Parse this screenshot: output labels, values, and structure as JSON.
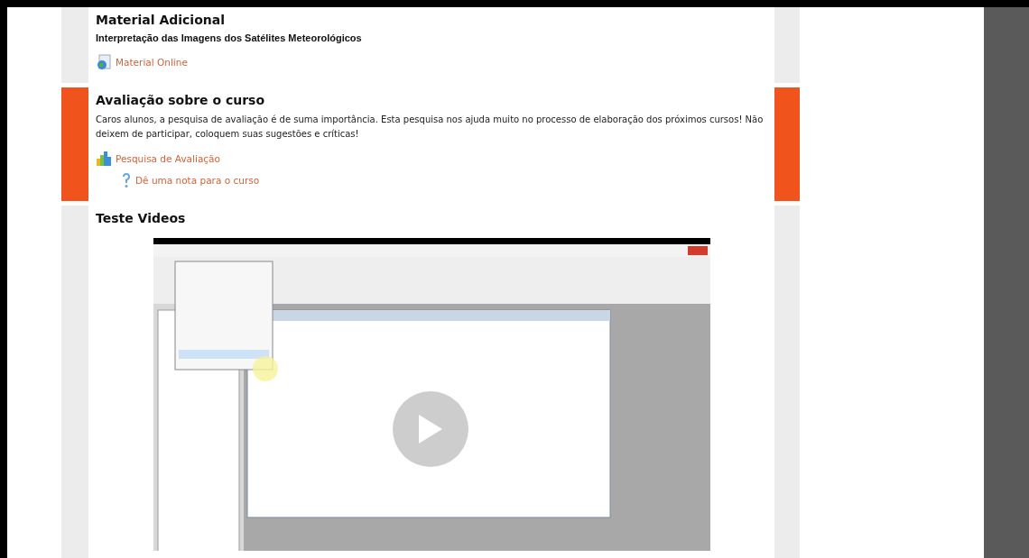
{
  "sections": [
    {
      "kind": "plain",
      "highlighted": false,
      "title": "Material Adicional",
      "subtitle": "Interpretação das Imagens dos Satélites Meteorológicos",
      "links": [
        {
          "kind": "globe",
          "label": "Material Online"
        }
      ]
    },
    {
      "kind": "plain",
      "highlighted": true,
      "title": "Avaliação sobre o curso",
      "text": "Caros alunos, a pesquisa de avaliação é de suma importância. Esta pesquisa nos ajuda muito no processo de elaboração dos próximos cursos! Não deixem de participar, coloquem suas sugestões e críticas!",
      "links": [
        {
          "kind": "chart",
          "label": "Pesquisa de Avaliação",
          "children": [
            {
              "kind": "question",
              "label": "Dê uma nota para o curso"
            }
          ]
        }
      ]
    },
    {
      "kind": "video",
      "highlighted": false,
      "title": "Teste Videos"
    }
  ]
}
